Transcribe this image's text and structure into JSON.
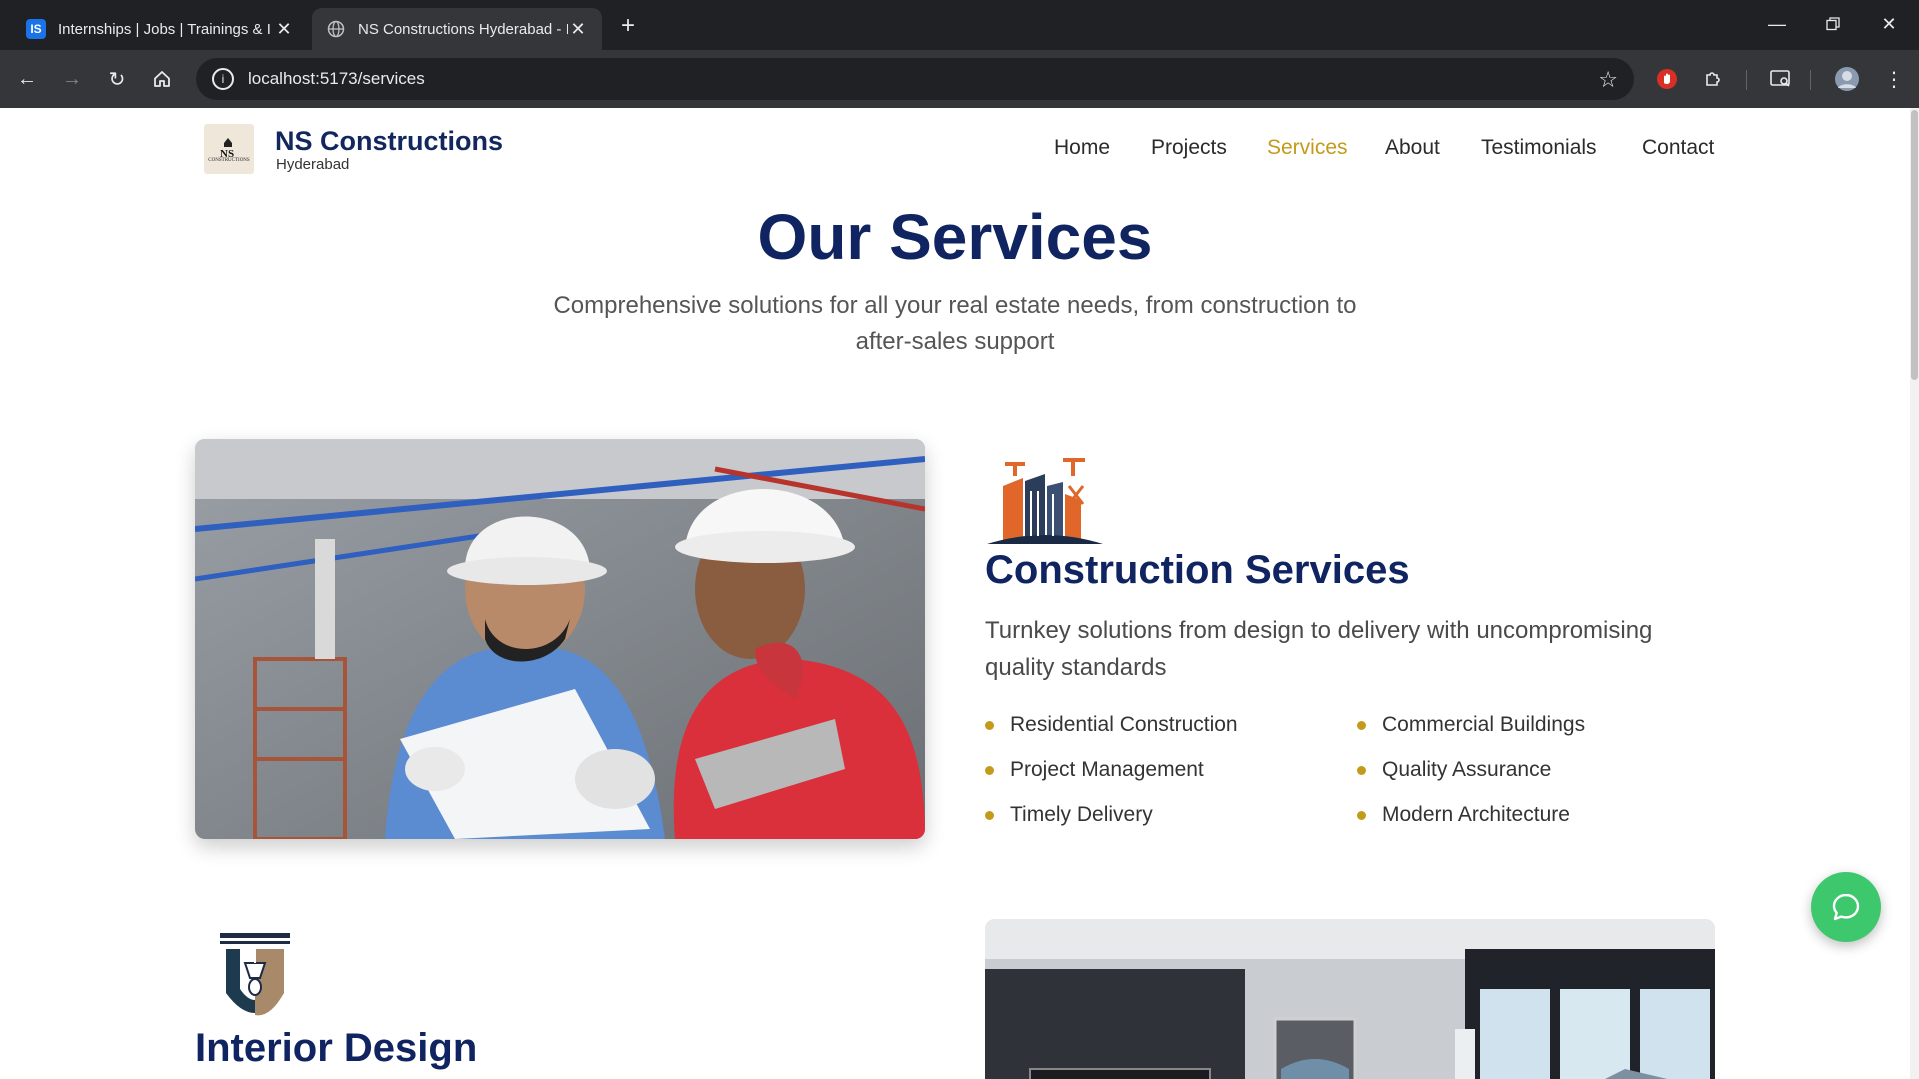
{
  "browser": {
    "tabs": [
      {
        "favicon": "IS",
        "title": "Internships | Jobs | Trainings & I",
        "active": false
      },
      {
        "favicon": "globe-icon",
        "title": "NS Constructions Hyderabad - I",
        "active": true
      }
    ],
    "new_tab": "+",
    "url": "localhost:5173/services"
  },
  "site": {
    "brand": "NS Constructions",
    "brand_sub": "Hyderabad",
    "logo_text_top": "NS",
    "logo_text_bottom": "CONSTRUCTIONS",
    "nav": [
      {
        "label": "Home",
        "active": false
      },
      {
        "label": "Projects",
        "active": false
      },
      {
        "label": "Services",
        "active": true
      },
      {
        "label": "About",
        "active": false
      },
      {
        "label": "Testimonials",
        "active": false
      },
      {
        "label": "Contact",
        "active": false
      }
    ],
    "accent": "#c49a1a",
    "navy": "#0f2460"
  },
  "hero": {
    "title": "Our Services",
    "subtitle": "Comprehensive solutions for all your real estate needs, from construction to after-sales support"
  },
  "services": [
    {
      "title": "Construction Services",
      "description": "Turnkey solutions from design to delivery with uncompromising quality standards",
      "features": [
        "Residential Construction",
        "Commercial Buildings",
        "Project Management",
        "Quality Assurance",
        "Timely Delivery",
        "Modern Architecture"
      ],
      "icon": "construction-building-icon",
      "image": "workers-reviewing-plans-photo"
    },
    {
      "title": "Interior Design",
      "icon": "interior-lamp-icon",
      "image": "interior-living-room-photo"
    }
  ],
  "chat": {
    "icon": "chat-bubble-icon",
    "color": "#3ec86e"
  }
}
